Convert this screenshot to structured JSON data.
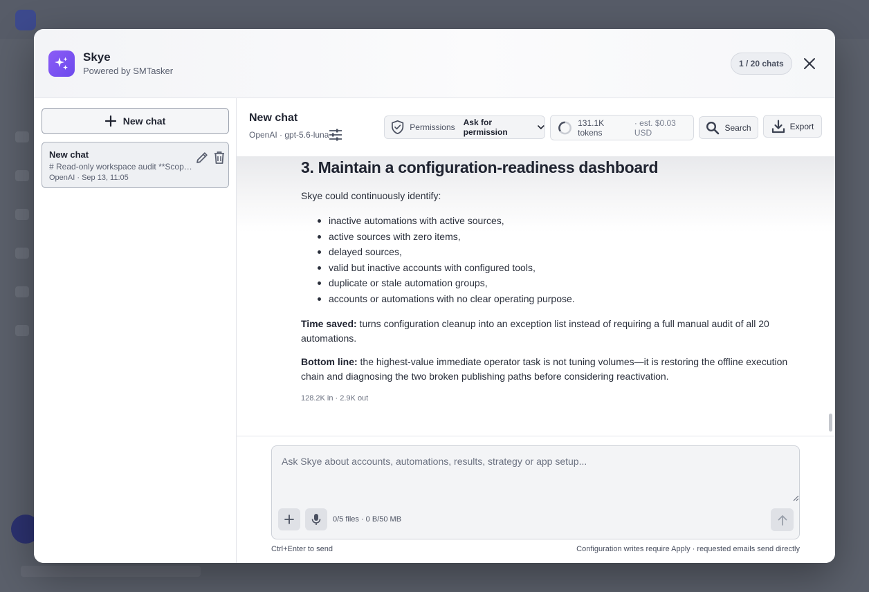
{
  "header": {
    "app_name": "Skye",
    "app_subtitle": "Powered by SMTasker",
    "chat_count": "1 / 20 chats"
  },
  "sidebar": {
    "new_chat_label": "New chat",
    "chats": [
      {
        "title": "New chat",
        "preview": "# Read-only workspace audit **Scope...",
        "meta": "OpenAI · Sep 13, 11:05"
      }
    ]
  },
  "toolbar": {
    "chat_title": "New chat",
    "model": "OpenAI · gpt-5.6-luna",
    "permissions_label": "Permissions",
    "permissions_value": "Ask for permission",
    "tokens": "131.1K tokens",
    "cost": "· est. $0.03 USD",
    "search_label": "Search",
    "export_label": "Export"
  },
  "message": {
    "heading": "3. Maintain a configuration-readiness dashboard",
    "intro": "Skye could continuously identify:",
    "bullets": [
      "inactive automations with active sources,",
      "active sources with zero items,",
      "delayed sources,",
      "valid but inactive accounts with configured tools,",
      "duplicate or stale automation groups,",
      "accounts or automations with no clear operating purpose."
    ],
    "time_saved_label": "Time saved:",
    "time_saved_text": " turns configuration cleanup into an exception list instead of requiring a full manual audit of all 20 automations.",
    "bottom_line_label": "Bottom line:",
    "bottom_line_text": " the highest-value immediate operator task is not tuning volumes—it is restoring the offline execution chain and diagnosing the two broken publishing paths before considering reactivation.",
    "usage": "128.2K in · 2.9K out"
  },
  "composer": {
    "placeholder": "Ask Skye about accounts, automations, results, strategy or app setup...",
    "files_status": "0/5 files · 0 B/50 MB",
    "hint_left": "Ctrl+Enter to send",
    "hint_right": "Configuration writes require Apply · requested emails send directly"
  },
  "colors": {
    "brand_gradient_start": "#8b5cf6",
    "brand_gradient_end": "#6d4aed",
    "overlay": "#4a4f5c"
  },
  "icons": [
    "sparkle-icon",
    "close-icon",
    "plus-icon",
    "edit-icon",
    "trash-icon",
    "sliders-icon",
    "shield-icon",
    "chevron-down-icon",
    "spinner-icon",
    "search-icon",
    "download-icon",
    "mic-icon",
    "arrow-up-icon"
  ]
}
